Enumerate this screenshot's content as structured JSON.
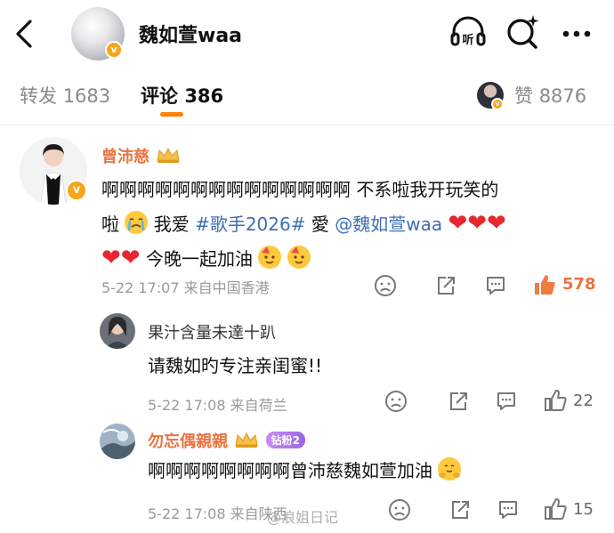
{
  "header": {
    "title": "魏如萱waa"
  },
  "tabs": [
    {
      "label": "转发",
      "count": "1683"
    },
    {
      "label": "评论",
      "count": "386"
    },
    {
      "label": "赞",
      "count": "8876"
    }
  ],
  "main_comment": {
    "author": "曾沛慈",
    "line1": "啊啊啊啊啊啊啊啊啊啊啊啊啊啊 不系啦我开玩笑的",
    "line2_a": "啦",
    "line2_b": " 我爱 ",
    "topic": "#歌手2026#",
    "line2_c": " 愛 ",
    "mention": "@魏如萱waa",
    "line3": " 今晚一起加油",
    "time": "5-22 17:07",
    "location": "来自中国香港",
    "likes": "578"
  },
  "reply1": {
    "author": "果汁含量未達十趴",
    "content": "请魏如旳专注亲闺蜜!!",
    "time": "5-22 17:08",
    "location": "来自荷兰",
    "likes": "22"
  },
  "reply2": {
    "author": "勿忘偶親親",
    "fan_badge": "钻粉2",
    "content": "啊啊啊啊啊啊啊啊曾沛慈魏如萱加油",
    "time": "5-22 17:08",
    "location": "来自陕西",
    "likes": "15"
  },
  "watermark": "@浪姐日记",
  "icons": [
    "back-icon",
    "listen-icon",
    "search-ai-icon",
    "more-icon",
    "verified-icon",
    "crown-icon",
    "heart-icon",
    "sad-face-icon",
    "share-icon",
    "comment-icon",
    "thumb-up-icon"
  ],
  "colors": {
    "accent": "#ff8200",
    "author": "#eb7340",
    "link": "#3e6fb5",
    "heart": "#e8262f",
    "verified": "#f7a51c"
  }
}
